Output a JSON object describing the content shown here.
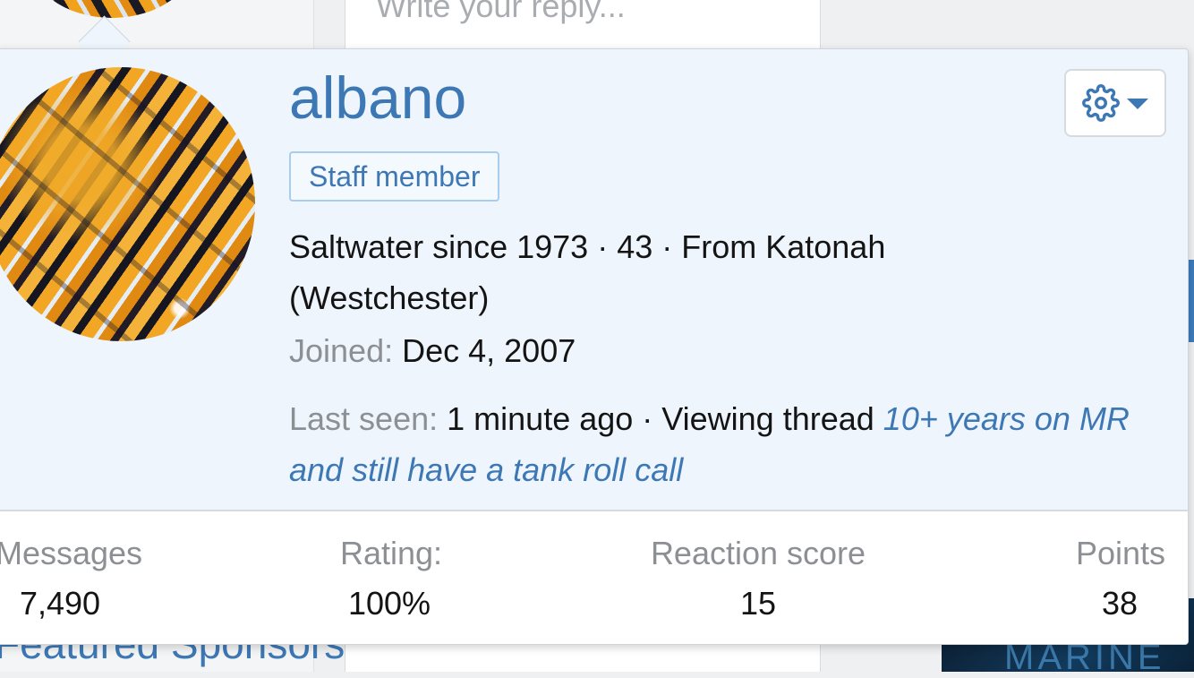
{
  "background": {
    "reply_placeholder": "Write your reply...",
    "sponsors_heading": "Featured Sponsors",
    "sponsor_banner_text": "MARINE"
  },
  "profile_popup": {
    "username": "albano",
    "badge": "Staff member",
    "user_title": "Saltwater since 1973 · 43 · From Katonah (Westchester)",
    "joined": {
      "label": "Joined:",
      "value": "Dec 4, 2007"
    },
    "last_seen": {
      "label": "Last seen:",
      "value": "1 minute ago · Viewing thread",
      "thread_link": "10+ years on MR and still have a tank roll call"
    },
    "settings_icon": "gear-icon",
    "stats": [
      {
        "label": "Messages",
        "value": "7,490"
      },
      {
        "label": "Rating:",
        "value": "100%"
      },
      {
        "label": "Reaction score",
        "value": "15"
      },
      {
        "label": "Points",
        "value": "38"
      }
    ]
  },
  "colors": {
    "accent": "#3d78b5",
    "popup_background": "#eef5fd",
    "muted_text": "#8c8f93",
    "text": "#141414"
  }
}
